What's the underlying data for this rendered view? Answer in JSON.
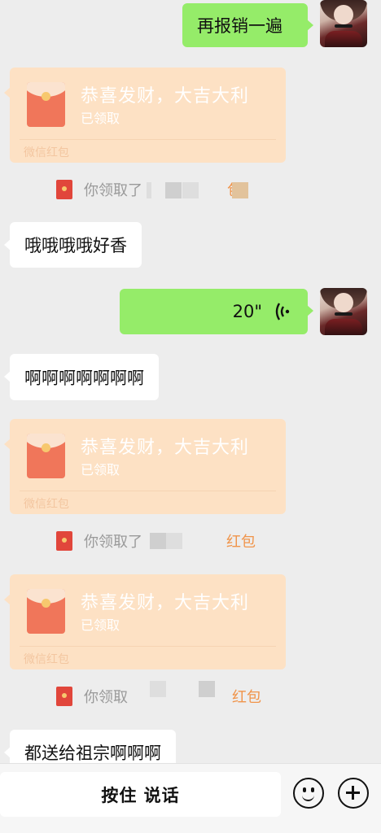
{
  "messages": {
    "out1": {
      "text": "再报销一遍"
    },
    "packet1": {
      "title": "恭喜发财，大吉大利",
      "status": "已领取",
      "footer": "微信红包"
    },
    "notice1": {
      "prefix": "你领取了",
      "suffix": "包"
    },
    "in1": {
      "text": "哦哦哦哦好香"
    },
    "voice": {
      "duration": "20\""
    },
    "in2": {
      "text": "啊啊啊啊啊啊啊"
    },
    "packet2": {
      "title": "恭喜发财，大吉大利",
      "status": "已领取",
      "footer": "微信红包"
    },
    "notice2": {
      "prefix": "你领取了",
      "suffix": "红包"
    },
    "packet3": {
      "title": "恭喜发财，大吉大利",
      "status": "已领取",
      "footer": "微信红包"
    },
    "notice3": {
      "prefix": "你领取",
      "suffix": "红包"
    },
    "in3": {
      "text": "都送给祖宗啊啊啊"
    }
  },
  "input_bar": {
    "hold_to_talk": "按住 说话",
    "emoji_icon": "emoji-icon",
    "plus_icon": "plus-icon"
  },
  "colors": {
    "background": "#ededed",
    "outgoing_bubble": "#95ec69",
    "incoming_bubble": "#ffffff",
    "red_packet": "#fde1c4",
    "red_packet_label": "#f0944a"
  }
}
